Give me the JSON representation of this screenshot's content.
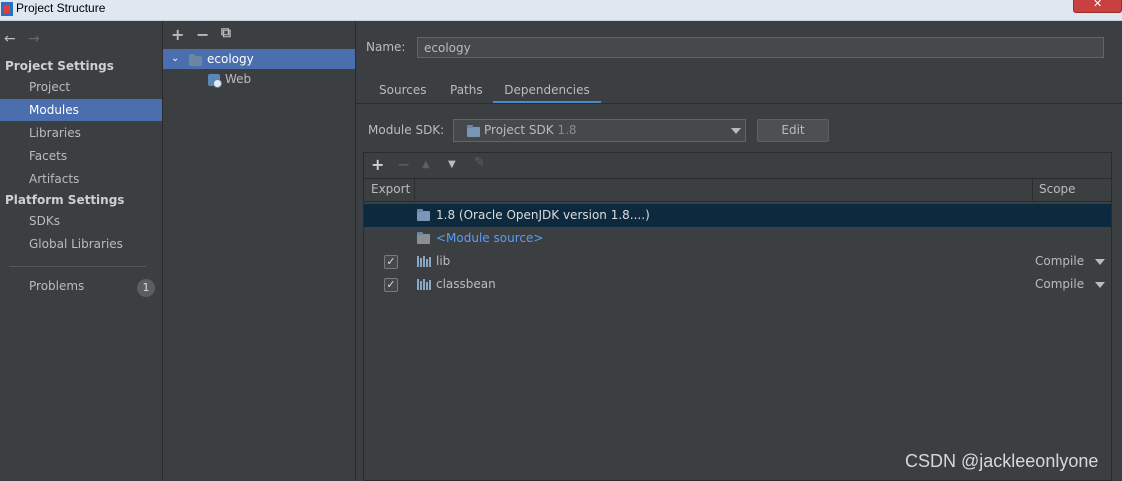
{
  "window": {
    "title": "Project Structure"
  },
  "nav": {
    "back_icon": "arrow-left-icon",
    "forward_icon": "arrow-right-icon",
    "project_settings_title": "Project Settings",
    "project_items": [
      "Project",
      "Modules",
      "Libraries",
      "Facets",
      "Artifacts"
    ],
    "platform_settings_title": "Platform Settings",
    "platform_items": [
      "SDKs",
      "Global Libraries"
    ],
    "problems_label": "Problems",
    "problems_count": "1",
    "selected": "Modules"
  },
  "tree": {
    "toolbar": [
      "+",
      "−",
      "⧉"
    ],
    "root": "ecology",
    "child": "Web"
  },
  "module": {
    "name_label": "Name:",
    "name_value": "ecology",
    "tabs": [
      "Sources",
      "Paths",
      "Dependencies"
    ],
    "active_tab": "Dependencies",
    "sdk_label": "Module SDK:",
    "sdk_value": "Project SDK",
    "sdk_version": "1.8",
    "edit_label": "Edit"
  },
  "dependencies": {
    "toolbar": [
      "+",
      "−",
      "▲",
      "▼",
      "✎"
    ],
    "columns": [
      "Export",
      "Scope"
    ],
    "rows": [
      {
        "name": "1.8 (Oracle OpenJDK version 1.8....)",
        "type": "sdk",
        "exported": null,
        "scope": ""
      },
      {
        "name": "<Module source>",
        "type": "source",
        "exported": null,
        "scope": ""
      },
      {
        "name": "lib",
        "type": "library",
        "exported": true,
        "scope": "Compile"
      },
      {
        "name": "classbean",
        "type": "library",
        "exported": true,
        "scope": "Compile"
      }
    ]
  },
  "watermark": "CSDN @jackleeonlyone",
  "colors": {
    "selection": "#4b6eaf",
    "link": "#589df6",
    "background": "#3c3f41"
  }
}
